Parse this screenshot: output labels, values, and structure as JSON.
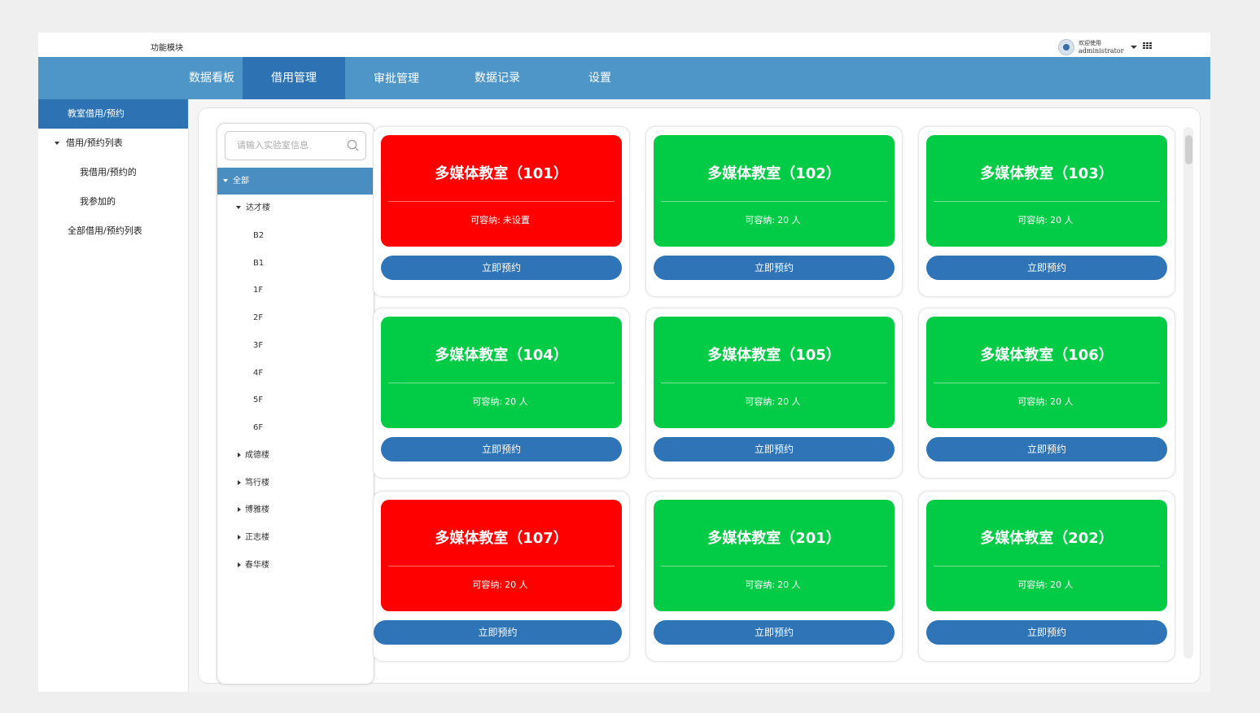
{
  "header": {
    "module_title": "功能模块",
    "welcome": "欢迎使用",
    "username": "administrator"
  },
  "nav": {
    "items": [
      "数据看板",
      "借用管理",
      "审批管理",
      "数据记录",
      "设置"
    ],
    "active": "借用管理"
  },
  "sidebar": {
    "items": [
      "教室借用/预约",
      "借用/预约列表",
      "我借用/预约的",
      "我参加的",
      "全部借用/预约列表"
    ],
    "active": "教室借用/预约"
  },
  "tree": {
    "search_placeholder": "请输入实验室信息",
    "root": "全部",
    "building_expanded": "达才楼",
    "floors": [
      "B2",
      "B1",
      "1F",
      "2F",
      "3F",
      "4F",
      "5F",
      "6F"
    ],
    "buildings_collapsed": [
      "成德楼",
      "笃行楼",
      "博雅楼",
      "正志楼",
      "春华楼"
    ]
  },
  "colors": {
    "occupied": "#fe0000",
    "available": "#02cc46",
    "button": "#2f74b6",
    "nav": "#4f96c8",
    "nav_active": "#2d73b4"
  },
  "capacity_label": "可容纳:",
  "book_label": "立即预约",
  "rooms": [
    {
      "name": "多媒体教室（101）",
      "capacity": "未设置",
      "status": "occupied"
    },
    {
      "name": "多媒体教室（102）",
      "capacity": "20 人",
      "status": "available"
    },
    {
      "name": "多媒体教室（103）",
      "capacity": "20 人",
      "status": "available"
    },
    {
      "name": "多媒体教室（104）",
      "capacity": "20 人",
      "status": "available"
    },
    {
      "name": "多媒体教室（105）",
      "capacity": "20 人",
      "status": "available"
    },
    {
      "name": "多媒体教室（106）",
      "capacity": "20 人",
      "status": "available"
    },
    {
      "name": "多媒体教室（107）",
      "capacity": "20 人",
      "status": "occupied"
    },
    {
      "name": "多媒体教室（201）",
      "capacity": "20 人",
      "status": "available"
    },
    {
      "name": "多媒体教室（202）",
      "capacity": "20 人",
      "status": "available"
    }
  ]
}
